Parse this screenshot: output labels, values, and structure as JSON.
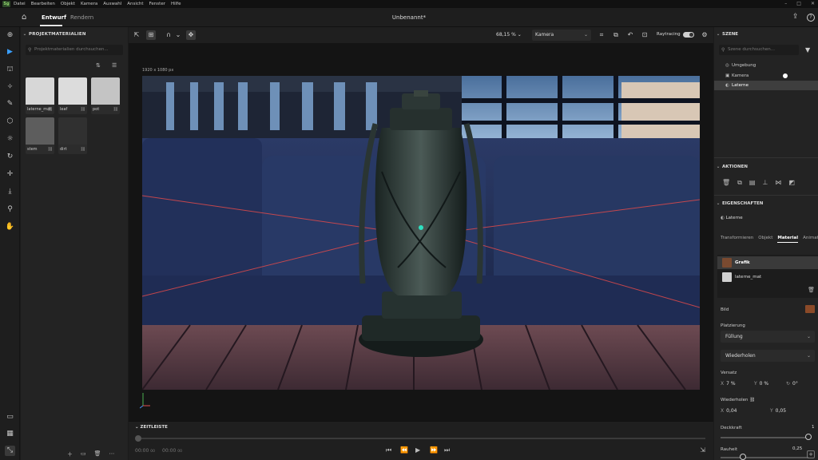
{
  "menu": {
    "logo": "Sg",
    "items": [
      "Datei",
      "Bearbeiten",
      "Objekt",
      "Kamera",
      "Auswahl",
      "Ansicht",
      "Fenster",
      "Hilfe"
    ],
    "window_controls": [
      "–",
      "□",
      "✕"
    ]
  },
  "appbar": {
    "tab_entwurf": "Entwurf",
    "tab_rendern": "Rendern",
    "document_title": "Unbenannt*"
  },
  "left_panel": {
    "title": "PROJEKTMATERIALIEN",
    "search_placeholder": "Projektmaterialien durchsuchen...",
    "materials": [
      {
        "name": "laterne_mat",
        "color": "#d7d7d7"
      },
      {
        "name": "leaf",
        "color": "#dcdcdc"
      },
      {
        "name": "pot",
        "color": "#c4c4c4"
      },
      {
        "name": "stem",
        "color": "#5d5d5d"
      },
      {
        "name": "dirt",
        "color": "#303030"
      }
    ]
  },
  "viewport": {
    "zoom": "68,15 %",
    "camera": "Kamera",
    "raytracing_label": "Raytracing",
    "resolution": "1920 x 1080 px"
  },
  "timeline": {
    "title": "ZEITLEISTE",
    "time_start": "00:00",
    "time_start_frames": "00",
    "time_end": "00:00",
    "time_end_frames": "00"
  },
  "right_panel": {
    "scene_title": "SZENE",
    "scene_search_placeholder": "Szene durchsuchen...",
    "scene_items": [
      {
        "label": "Umgebung",
        "icon": "globe-icon"
      },
      {
        "label": "Kamera",
        "icon": "camera-icon"
      },
      {
        "label": "Laterne",
        "icon": "object-icon",
        "selected": true
      }
    ],
    "actions_title": "AKTIONEN",
    "properties_title": "EIGENSCHAFTEN",
    "object_name": "Laterne",
    "tabs": [
      "Transformieren",
      "Objekt",
      "Material",
      "Animation"
    ],
    "active_tab": "Material",
    "layers": [
      {
        "label": "Grafik",
        "selected": true
      },
      {
        "label": "laterne_mat",
        "selected": false
      }
    ],
    "bild_label": "Bild",
    "platzierung_label": "Platzierung",
    "fuellung": "Füllung",
    "wiederholen_dd": "Wiederholen",
    "versatz_label": "Versatz",
    "versatz_x_key": "X",
    "versatz_x": "7 %",
    "versatz_y_key": "Y",
    "versatz_y": "0 %",
    "rotation": "0°",
    "wiederholen_label": "Wiederholen",
    "wied_x_key": "X",
    "wied_x": "0,04",
    "wied_y_key": "Y",
    "wied_y": "0,05",
    "deckkraft_label": "Deckkraft",
    "deckkraft_value": "1",
    "deckkraft_fraction": 1.0,
    "rauheit_label": "Rauheit",
    "rauheit_value": "0,25",
    "rauheit_fraction": 0.25
  }
}
